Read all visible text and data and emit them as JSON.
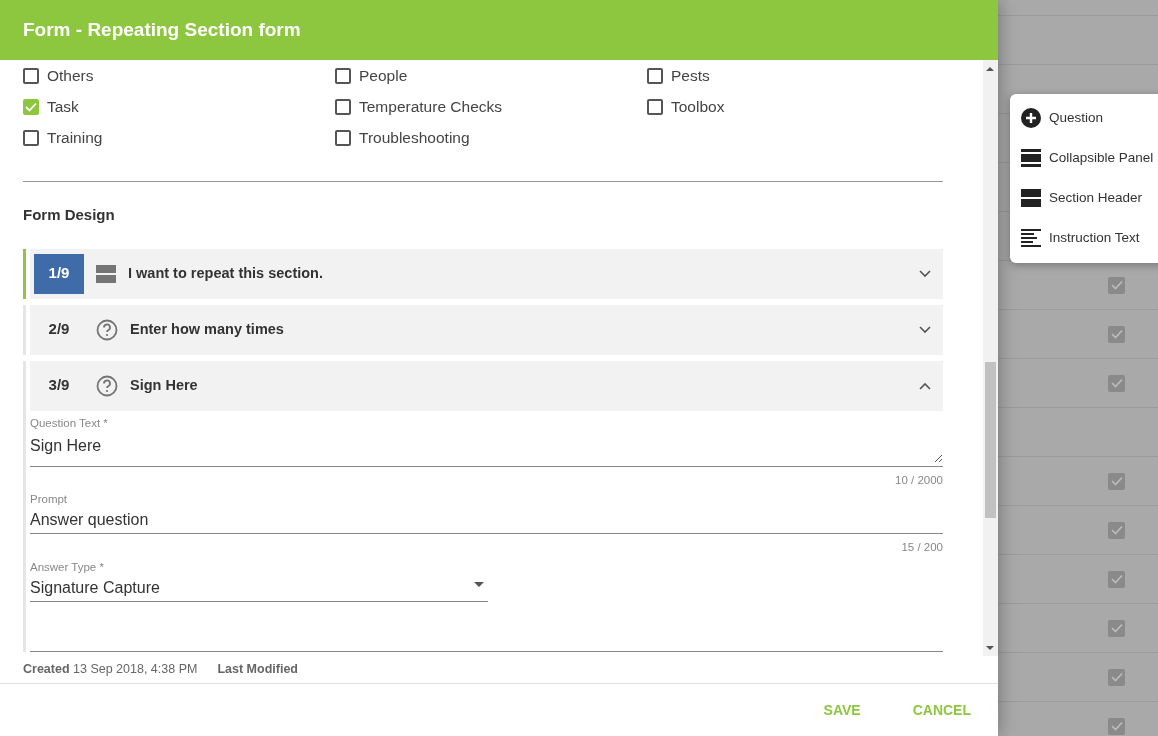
{
  "dialog": {
    "title": "Form - Repeating Section form",
    "categories": [
      {
        "label": "Others",
        "checked": false
      },
      {
        "label": "People",
        "checked": false
      },
      {
        "label": "Pests",
        "checked": false
      },
      {
        "label": "Task",
        "checked": true
      },
      {
        "label": "Temperature Checks",
        "checked": false
      },
      {
        "label": "Toolbox",
        "checked": false
      },
      {
        "label": "Training",
        "checked": false
      },
      {
        "label": "Troubleshooting",
        "checked": false
      }
    ],
    "section_title": "Form Design",
    "items": [
      {
        "number": "1/9",
        "title": "I want to repeat this section.",
        "kind": "section",
        "selected": true,
        "expanded": false
      },
      {
        "number": "2/9",
        "title": "Enter how many times",
        "kind": "question",
        "selected": false,
        "expanded": false
      },
      {
        "number": "3/9",
        "title": "Sign Here",
        "kind": "question",
        "selected": false,
        "expanded": true
      }
    ],
    "fields": [
      {
        "kind": "textarea",
        "label": "Question Text *",
        "value": "Sign Here",
        "counter": "10 / 2000"
      },
      {
        "kind": "text",
        "label": "Prompt",
        "value": "Answer question",
        "counter": "15 / 200"
      },
      {
        "kind": "select",
        "label": "Answer Type *",
        "value": "Signature Capture"
      },
      {
        "kind": "blank"
      }
    ],
    "meta": [
      {
        "label": "Created",
        "value": "13 Sep 2018, 4:38 PM"
      },
      {
        "label": "Last Modified"
      }
    ],
    "buttons": [
      "SAVE",
      "CANCEL"
    ]
  },
  "add_menu": [
    {
      "label": "Question",
      "kind": "question"
    },
    {
      "label": "Collapsible Panel",
      "kind": "panel"
    },
    {
      "label": "Section Header",
      "kind": "header"
    },
    {
      "label": "Instruction Text",
      "kind": "instruction"
    }
  ],
  "background_rows": [
    {
      "checked": false
    },
    {
      "checked": false
    },
    {
      "checked": false
    },
    {
      "checked": false
    },
    {
      "checked": false
    },
    {
      "checked": true
    },
    {
      "checked": true
    },
    {
      "checked": true
    },
    {
      "checked": false
    },
    {
      "checked": true
    },
    {
      "checked": true
    },
    {
      "checked": true
    },
    {
      "checked": true
    },
    {
      "checked": true
    },
    {
      "checked": true
    }
  ]
}
